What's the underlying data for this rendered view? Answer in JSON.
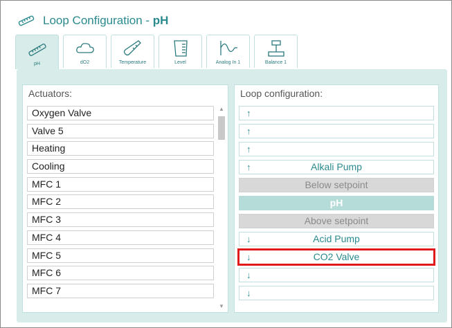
{
  "header": {
    "title_prefix": "Loop Configuration - ",
    "title_loop": "pH"
  },
  "tabs": [
    {
      "label": "pH",
      "icon": "thermometer-icon",
      "active": true
    },
    {
      "label": "dO2",
      "icon": "cloud-icon",
      "active": false
    },
    {
      "label": "Temperature",
      "icon": "thermometer-diagonal-icon",
      "active": false
    },
    {
      "label": "Level",
      "icon": "beaker-icon",
      "active": false
    },
    {
      "label": "Analog In 1",
      "icon": "wave-icon",
      "active": false
    },
    {
      "label": "Balance 1",
      "icon": "scale-icon",
      "active": false
    }
  ],
  "actuators": {
    "heading": "Actuators:",
    "items": [
      "Oxygen Valve",
      "Valve 5",
      "Heating",
      "Cooling",
      "MFC 1",
      "MFC 2",
      "MFC 3",
      "MFC 4",
      "MFC 5",
      "MFC 6",
      "MFC 7"
    ]
  },
  "loop": {
    "heading": "Loop configuration:",
    "up_arrow": "↑",
    "down_arrow": "↓",
    "slots": [
      {
        "type": "up",
        "label": ""
      },
      {
        "type": "up",
        "label": ""
      },
      {
        "type": "up",
        "label": ""
      },
      {
        "type": "up",
        "label": "Alkali Pump"
      },
      {
        "type": "setpoint",
        "label": "Below setpoint"
      },
      {
        "type": "center",
        "label": "pH"
      },
      {
        "type": "setpoint",
        "label": "Above setpoint"
      },
      {
        "type": "down",
        "label": "Acid Pump"
      },
      {
        "type": "down",
        "label": "CO2 Valve",
        "highlighted": true
      },
      {
        "type": "down",
        "label": ""
      },
      {
        "type": "down",
        "label": ""
      }
    ]
  },
  "colors": {
    "accent": "#2a8a8e",
    "panel_bg": "#d8ecea",
    "highlight": "#e01a1a"
  }
}
